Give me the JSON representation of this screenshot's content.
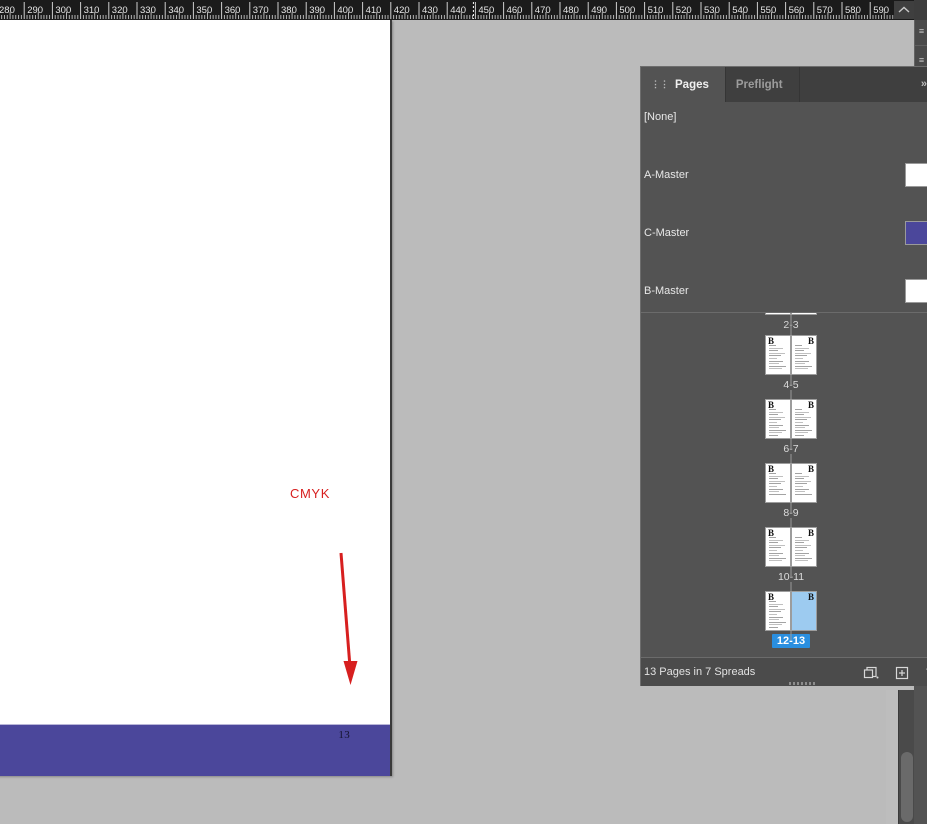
{
  "app": {
    "canvas_bg": "#bbbbbb",
    "page_bg": "#ffffff",
    "band_color": "#4b479b",
    "annotation_color": "#d71f1f",
    "selection_color": "#2a8fe0"
  },
  "ruler": {
    "unit_labels": [
      "280",
      "290",
      "300",
      "310",
      "320",
      "330",
      "340",
      "350",
      "360",
      "370",
      "380",
      "390",
      "400",
      "410",
      "420",
      "430",
      "440",
      "450",
      "460",
      "470",
      "480",
      "490",
      "500",
      "510",
      "520",
      "530",
      "540",
      "550",
      "560",
      "570",
      "580",
      "590"
    ],
    "first_label_clipped": "280",
    "scroll_up_icon": "chevron-up-icon"
  },
  "document": {
    "page_number": "13",
    "annotation_text": "CMYK",
    "arrow_icon": "down-arrow-annotation"
  },
  "panel": {
    "tabs": [
      {
        "label": "Pages",
        "active": true
      },
      {
        "label": "Preflight",
        "active": false
      }
    ],
    "drag_icon": "panel-drag-icon",
    "collapse_icon": "double-chevron-right-icon",
    "masters": [
      {
        "name": "[None]",
        "thumbs": [
          "white"
        ]
      },
      {
        "name": "A-Master",
        "thumbs": [
          "white",
          "white"
        ]
      },
      {
        "name": "C-Master",
        "thumbs": [
          "purple",
          "purple"
        ]
      },
      {
        "name": "B-Master",
        "thumbs": [
          "white",
          "white"
        ]
      }
    ],
    "spreads": [
      {
        "label": "2-3",
        "clipped": true,
        "selected": false,
        "pages": [
          {
            "master": "B",
            "state": "normal"
          },
          {
            "master": "B",
            "state": "normal"
          }
        ]
      },
      {
        "label": "4-5",
        "clipped": false,
        "selected": false,
        "pages": [
          {
            "master": "B",
            "state": "normal"
          },
          {
            "master": "B",
            "state": "normal"
          }
        ]
      },
      {
        "label": "6-7",
        "clipped": false,
        "selected": false,
        "pages": [
          {
            "master": "B",
            "state": "normal"
          },
          {
            "master": "B",
            "state": "normal"
          }
        ]
      },
      {
        "label": "8-9",
        "clipped": false,
        "selected": false,
        "pages": [
          {
            "master": "B",
            "state": "normal"
          },
          {
            "master": "B",
            "state": "normal"
          }
        ]
      },
      {
        "label": "10-11",
        "clipped": false,
        "selected": false,
        "pages": [
          {
            "master": "B",
            "state": "normal"
          },
          {
            "master": "B",
            "state": "normal"
          }
        ]
      },
      {
        "label": "12-13",
        "clipped": false,
        "selected": true,
        "pages": [
          {
            "master": "B",
            "state": "normal"
          },
          {
            "master": "B",
            "state": "blue"
          }
        ]
      }
    ],
    "status": {
      "text": "13 Pages in 7 Spreads",
      "icons": [
        "edit-page-size-icon",
        "new-page-icon",
        "delete-page-icon"
      ]
    }
  },
  "dock": {
    "icons": [
      "panel-icon-1",
      "panel-icon-2",
      "panel-icon-3"
    ]
  }
}
